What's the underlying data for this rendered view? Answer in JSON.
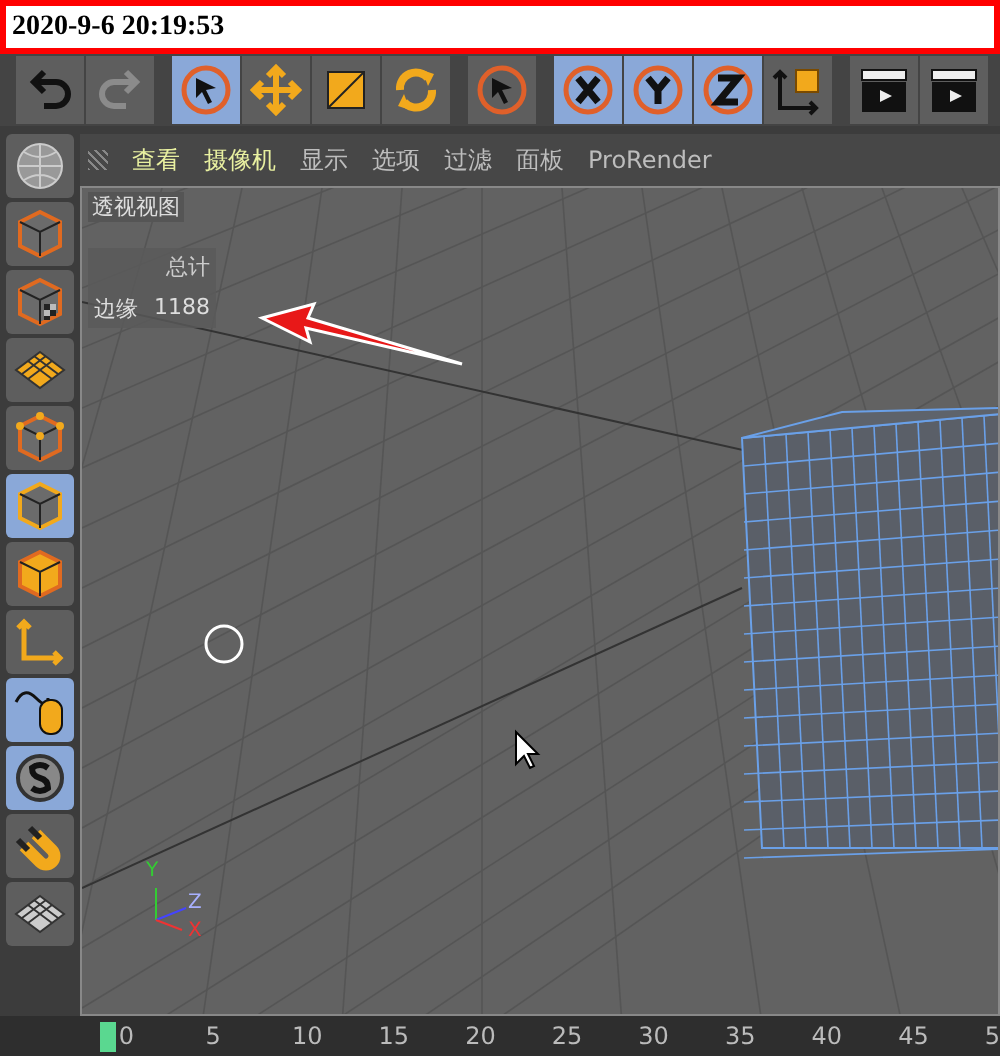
{
  "title_bar": {
    "datetime": "2020-9-6 20:19:53"
  },
  "toolbar": [
    {
      "kind": "undo",
      "selected": false,
      "disabled": false
    },
    {
      "kind": "redo",
      "selected": false,
      "disabled": true
    },
    {
      "kind": "select",
      "selected": true,
      "disabled": false
    },
    {
      "kind": "move",
      "selected": false,
      "disabled": false
    },
    {
      "kind": "scale",
      "selected": false,
      "disabled": false
    },
    {
      "kind": "rotate",
      "selected": false,
      "disabled": false
    },
    {
      "kind": "select",
      "selected": false,
      "disabled": false
    },
    {
      "kind": "x",
      "selected": true,
      "disabled": false
    },
    {
      "kind": "y",
      "selected": true,
      "disabled": false
    },
    {
      "kind": "z",
      "selected": true,
      "disabled": false
    },
    {
      "kind": "coords",
      "selected": false,
      "disabled": false
    },
    {
      "kind": "clapper",
      "selected": false,
      "disabled": false
    },
    {
      "kind": "clapper",
      "selected": false,
      "disabled": false
    }
  ],
  "mode_toolbar": [
    {
      "kind": "globe",
      "selected": false
    },
    {
      "kind": "cube",
      "selected": false
    },
    {
      "kind": "texture",
      "selected": false
    },
    {
      "kind": "plane",
      "selected": false
    },
    {
      "kind": "points",
      "selected": false
    },
    {
      "kind": "edges",
      "selected": true
    },
    {
      "kind": "polygons",
      "selected": false
    },
    {
      "kind": "axis",
      "selected": false
    },
    {
      "kind": "mouse",
      "selected": true
    },
    {
      "kind": "snap",
      "selected": true
    },
    {
      "kind": "magnet",
      "selected": false
    },
    {
      "kind": "floor",
      "selected": false
    }
  ],
  "viewport_menu": [
    {
      "label": "查看",
      "highlighted": true
    },
    {
      "label": "摄像机",
      "highlighted": true
    },
    {
      "label": "显示",
      "highlighted": false
    },
    {
      "label": "选项",
      "highlighted": false
    },
    {
      "label": "过滤",
      "highlighted": false
    },
    {
      "label": "面板",
      "highlighted": false
    },
    {
      "label": "ProRender",
      "highlighted": false
    }
  ],
  "viewport": {
    "name": "透视视图",
    "stats": {
      "header": "总计",
      "rows": [
        {
          "label": "边缘",
          "value": "1188"
        }
      ]
    },
    "axis_labels": {
      "y": "Y",
      "z": "Z",
      "x": "X"
    }
  },
  "timeline": {
    "ticks": [
      "0",
      "5",
      "10",
      "15",
      "20",
      "25",
      "30",
      "35",
      "40",
      "45",
      "5"
    ]
  }
}
